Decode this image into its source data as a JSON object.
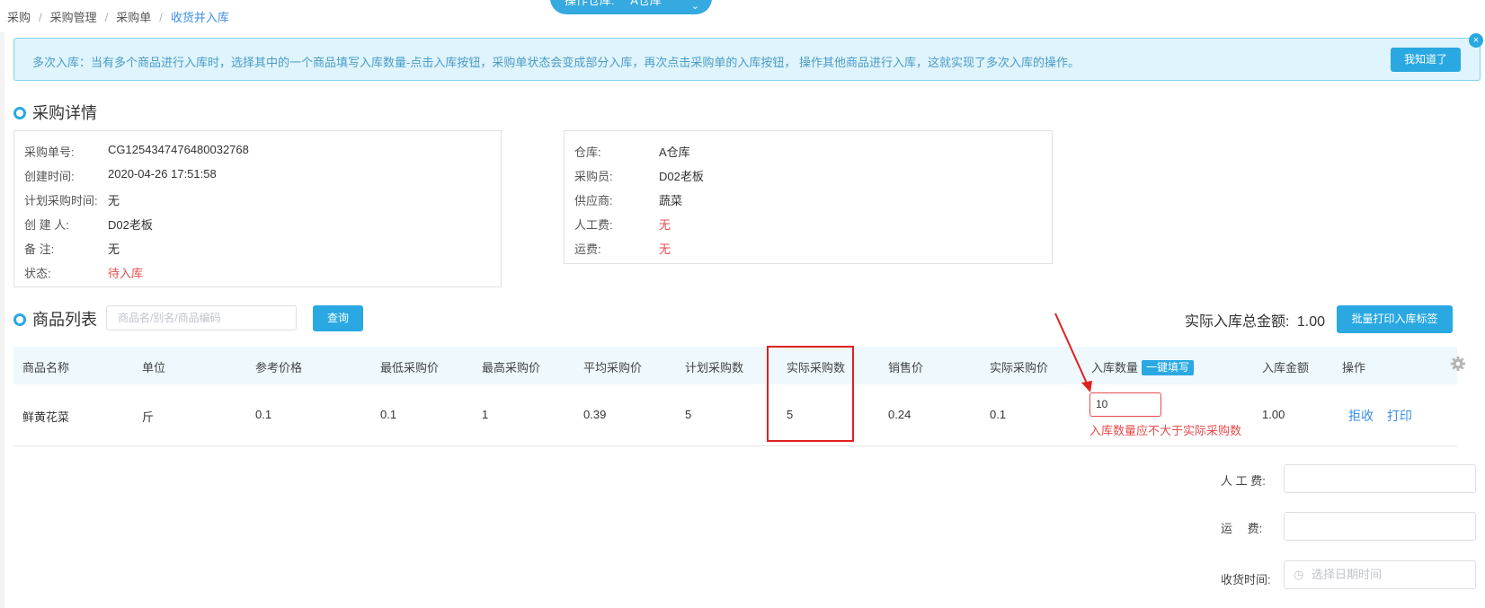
{
  "breadcrumb": [
    "采购",
    "采购管理",
    "采购单",
    "收货并入库"
  ],
  "warehouse_selector": {
    "label": "操作仓库:",
    "value": "A仓库"
  },
  "alert": {
    "text": "多次入库：当有多个商品进行入库时，选择其中的一个商品填写入库数量-点击入库按钮，采购单状态会变成部分入库，再次点击采购单的入库按钮， 操作其他商品进行入库，这就实现了多次入库的操作。",
    "button": "我知道了",
    "close_icon": "×"
  },
  "detail_title": "采购详情",
  "detail_left": [
    {
      "label": "采购单号:",
      "value": "CG1254347476480032768"
    },
    {
      "label": "创建时间:",
      "value": "2020-04-26 17:51:58"
    },
    {
      "label": "计划采购时间:",
      "value": "无"
    },
    {
      "label": "创 建 人:",
      "value": "D02老板"
    },
    {
      "label": "备 注:",
      "value": "无"
    },
    {
      "label": "状态:",
      "value": "待入库"
    }
  ],
  "detail_right": [
    {
      "label": "仓库:",
      "value": "A仓库"
    },
    {
      "label": "采购员:",
      "value": "D02老板"
    },
    {
      "label": "供应商:",
      "value": "蔬菜"
    },
    {
      "label": "人工费:",
      "value": "无"
    },
    {
      "label": "运费:",
      "value": "无"
    }
  ],
  "goods_title": "商品列表",
  "search": {
    "placeholder": "商品名/别名/商品编码",
    "button": "查询"
  },
  "total": {
    "label": "实际入库总金额:",
    "value": "1.00"
  },
  "print_button": "批量打印入库标签",
  "table": {
    "headers": [
      "商品名称",
      "单位",
      "参考价格",
      "最低采购价",
      "最高采购价",
      "平均采购价",
      "计划采购数",
      "实际采购数",
      "销售价",
      "实际采购价",
      "入库数量",
      "入库金额",
      "操作"
    ],
    "fill_badge": "一键填写",
    "row": {
      "name": "鲜黄花菜",
      "unit": "斤",
      "ref_price": "0.1",
      "min_price": "0.1",
      "max_price": "1",
      "avg_price": "0.39",
      "plan_qty": "5",
      "actual_qty": "5",
      "sale_price": "0.24",
      "actual_price": "0.1",
      "in_qty": "10",
      "in_amount": "1.00",
      "error": "入库数量应不大于实际采购数",
      "op_reject": "拒收",
      "op_print": "打印"
    }
  },
  "form": {
    "labor_label": "人 工 费:",
    "freight_label": "运　 费:",
    "date_label": "收货时间:",
    "date_placeholder": "选择日期时间"
  },
  "colors": {
    "accent": "#29a8e2",
    "error": "#e64b4b",
    "annotation": "#e02020"
  }
}
